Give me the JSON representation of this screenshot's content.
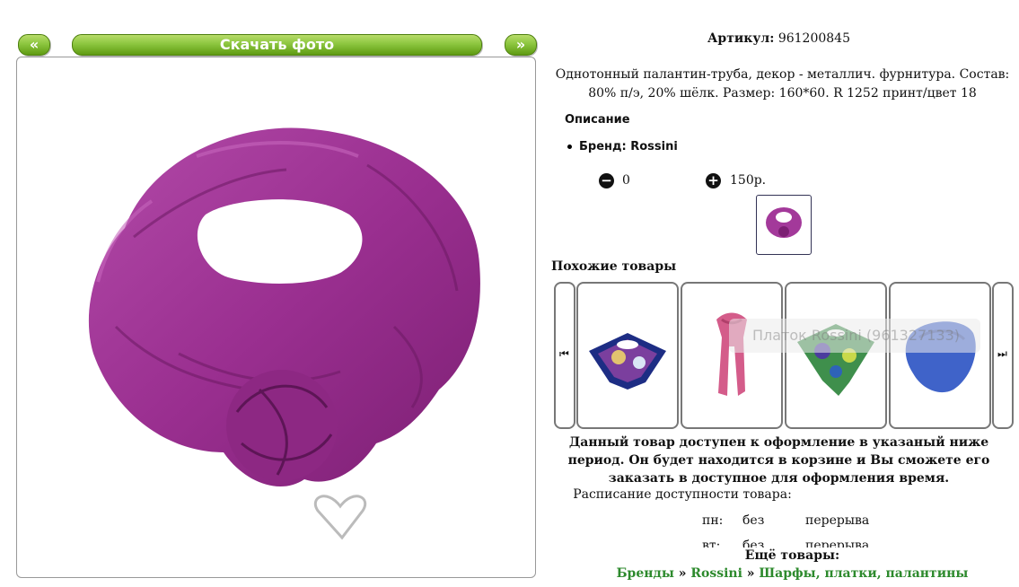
{
  "photo_nav": {
    "prev_label": "«",
    "download_label": "Скачать фото",
    "next_label": "»"
  },
  "product": {
    "sku_label": "Артикул:",
    "sku_value": "961200845",
    "description": "Однотонный палантин-труба, декор - металлич. фурнитура. Состав: 80% п/э, 20% шёлк. Размер: 160*60. R 1252 принт/цвет 18",
    "description_heading": "Описание",
    "brand_line": "Бренд: Rossini",
    "quantity": "0",
    "price": "150р.",
    "image_color": "#a3399a"
  },
  "similar": {
    "title": "Похожие товары",
    "tooltip": "Платок Rossini (961327133)",
    "items": [
      {
        "icon": "scarf-blue-print-icon",
        "color": "#1d2d84"
      },
      {
        "icon": "scarf-pink-icon",
        "color": "#d45c8a"
      },
      {
        "icon": "scarf-green-print-icon",
        "color": "#3f8f4c"
      },
      {
        "icon": "scarf-blue-icon",
        "color": "#3f63c9"
      }
    ]
  },
  "availability": {
    "notice": "Данный товар доступен к оформление в указаный ниже период. Он будет находится в корзине и Вы сможете его заказать в доступное для оформления время.",
    "schedule_title": "Расписание доступности товара:",
    "rows": [
      {
        "day": "пн:",
        "from": "без",
        "to": "перерыва"
      },
      {
        "day": "вт:",
        "from": "без",
        "to": "перерыва"
      }
    ]
  },
  "more": {
    "label": "Ещё товары:",
    "crumbs": [
      "Бренды",
      "Rossini",
      "Шарфы, платки, палантины"
    ],
    "sep": "»"
  }
}
